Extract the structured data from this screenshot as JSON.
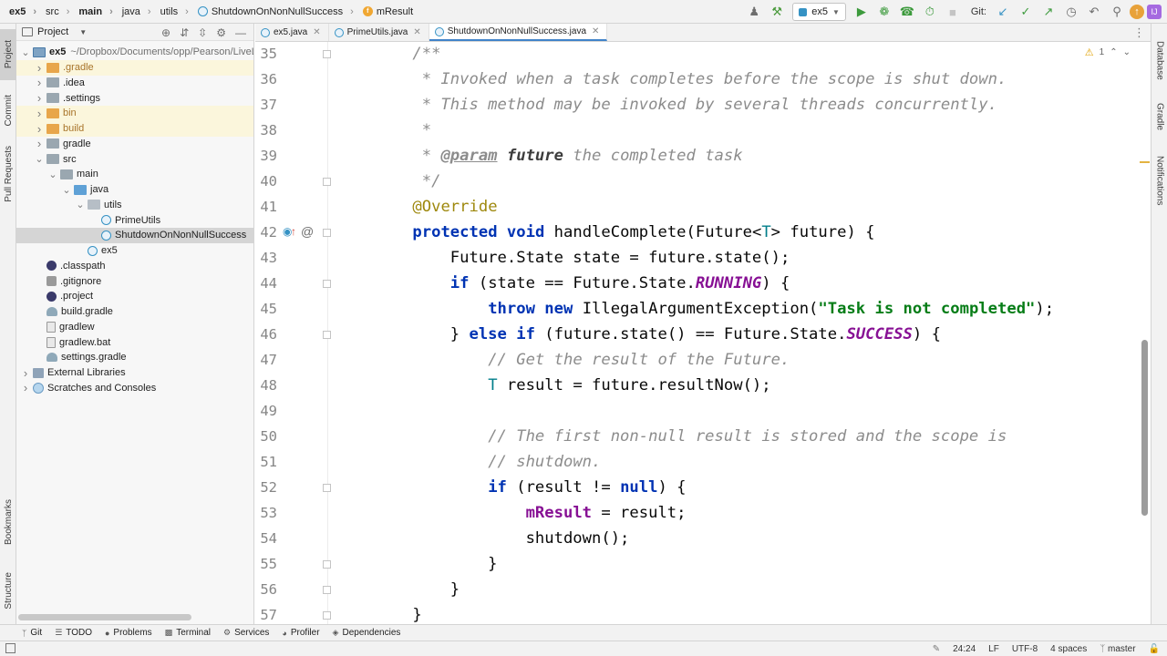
{
  "breadcrumbs": [
    "ex5",
    "src",
    "main",
    "java",
    "utils",
    "ShutdownOnNonNullSuccess",
    "mResult"
  ],
  "toolbar": {
    "run_config": "ex5",
    "git_label": "Git:"
  },
  "left_tools": [
    "Project",
    "Commit",
    "Pull Requests",
    "Bookmarks",
    "Structure"
  ],
  "right_tools": [
    "Database",
    "Gradle",
    "Notifications"
  ],
  "project_panel": {
    "title": "Project",
    "tree": [
      {
        "label": "ex5",
        "path": "~/Dropbox/Documents/opp/Pearson/LiveL",
        "depth": 0,
        "arrow": "down",
        "icon": "module-folder-icon"
      },
      {
        "label": ".gradle",
        "depth": 1,
        "arrow": "right",
        "icon": "folder-orange-icon"
      },
      {
        "label": ".idea",
        "depth": 1,
        "arrow": "right",
        "icon": "folder-icon"
      },
      {
        "label": ".settings",
        "depth": 1,
        "arrow": "right",
        "icon": "folder-icon"
      },
      {
        "label": "bin",
        "depth": 1,
        "arrow": "right",
        "icon": "folder-orange-icon"
      },
      {
        "label": "build",
        "depth": 1,
        "arrow": "right",
        "icon": "folder-orange-icon"
      },
      {
        "label": "gradle",
        "depth": 1,
        "arrow": "right",
        "icon": "folder-icon"
      },
      {
        "label": "src",
        "depth": 1,
        "arrow": "down",
        "icon": "folder-icon"
      },
      {
        "label": "main",
        "depth": 2,
        "arrow": "down",
        "icon": "folder-icon"
      },
      {
        "label": "java",
        "depth": 3,
        "arrow": "down",
        "icon": "folder-blue-icon"
      },
      {
        "label": "utils",
        "depth": 4,
        "arrow": "down",
        "icon": "package-icon"
      },
      {
        "label": "PrimeUtils",
        "depth": 5,
        "arrow": "",
        "icon": "class-icon"
      },
      {
        "label": "ShutdownOnNonNullSuccess",
        "depth": 5,
        "arrow": "",
        "icon": "class-icon"
      },
      {
        "label": "ex5",
        "depth": 4,
        "arrow": "",
        "icon": "class-icon"
      },
      {
        "label": ".classpath",
        "depth": 1,
        "arrow": "",
        "icon": "eclipse-icon"
      },
      {
        "label": ".gitignore",
        "depth": 1,
        "arrow": "",
        "icon": "git-file-icon"
      },
      {
        "label": ".project",
        "depth": 1,
        "arrow": "",
        "icon": "eclipse-icon"
      },
      {
        "label": "build.gradle",
        "depth": 1,
        "arrow": "",
        "icon": "gradle-icon"
      },
      {
        "label": "gradlew",
        "depth": 1,
        "arrow": "",
        "icon": "script-icon"
      },
      {
        "label": "gradlew.bat",
        "depth": 1,
        "arrow": "",
        "icon": "script-icon"
      },
      {
        "label": "settings.gradle",
        "depth": 1,
        "arrow": "",
        "icon": "gradle-icon"
      },
      {
        "label": "External Libraries",
        "depth": 0,
        "arrow": "right",
        "icon": "library-icon"
      },
      {
        "label": "Scratches and Consoles",
        "depth": 0,
        "arrow": "right",
        "icon": "scratch-icon"
      }
    ]
  },
  "editor_tabs": [
    {
      "label": "ex5.java",
      "active": false
    },
    {
      "label": "PrimeUtils.java",
      "active": false
    },
    {
      "label": "ShutdownOnNonNullSuccess.java",
      "active": true
    }
  ],
  "editor": {
    "inspection_count": "1",
    "lines": [
      {
        "num": "35",
        "tokens": [
          {
            "t": "    /**",
            "c": "cmt"
          }
        ]
      },
      {
        "num": "36",
        "tokens": [
          {
            "t": "     * Invoked when a task completes before the scope is shut down.",
            "c": "cmt"
          }
        ]
      },
      {
        "num": "37",
        "tokens": [
          {
            "t": "     * This method may be invoked by several threads concurrently.",
            "c": "cmt"
          }
        ]
      },
      {
        "num": "38",
        "tokens": [
          {
            "t": "     *",
            "c": "cmt"
          }
        ]
      },
      {
        "num": "39",
        "tokens": [
          {
            "t": "     * ",
            "c": "cmt"
          },
          {
            "t": "@param",
            "c": "doctag"
          },
          {
            "t": " ",
            "c": "cmt"
          },
          {
            "t": "future",
            "c": "docparam"
          },
          {
            "t": " the completed task",
            "c": "cmt"
          }
        ]
      },
      {
        "num": "40",
        "tokens": [
          {
            "t": "     */",
            "c": "cmt"
          }
        ]
      },
      {
        "num": "41",
        "tokens": [
          {
            "t": "    ",
            "c": ""
          },
          {
            "t": "@Override",
            "c": "ann"
          }
        ]
      },
      {
        "num": "42",
        "tokens": [
          {
            "t": "    ",
            "c": ""
          },
          {
            "t": "protected",
            "c": "kw"
          },
          {
            "t": " ",
            "c": ""
          },
          {
            "t": "void",
            "c": "kw"
          },
          {
            "t": " handleComplete(Future<",
            "c": ""
          },
          {
            "t": "T",
            "c": "type"
          },
          {
            "t": "> future) {",
            "c": ""
          }
        ]
      },
      {
        "num": "43",
        "tokens": [
          {
            "t": "        Future.State state = future.state();",
            "c": ""
          }
        ]
      },
      {
        "num": "44",
        "tokens": [
          {
            "t": "        ",
            "c": ""
          },
          {
            "t": "if",
            "c": "kw"
          },
          {
            "t": " (state == Future.State.",
            "c": ""
          },
          {
            "t": "RUNNING",
            "c": "static"
          },
          {
            "t": ") {",
            "c": ""
          }
        ]
      },
      {
        "num": "45",
        "tokens": [
          {
            "t": "            ",
            "c": ""
          },
          {
            "t": "throw",
            "c": "kw"
          },
          {
            "t": " ",
            "c": ""
          },
          {
            "t": "new",
            "c": "kw"
          },
          {
            "t": " IllegalArgumentException(",
            "c": ""
          },
          {
            "t": "\"Task is not completed\"",
            "c": "str"
          },
          {
            "t": ");",
            "c": ""
          }
        ]
      },
      {
        "num": "46",
        "tokens": [
          {
            "t": "        } ",
            "c": ""
          },
          {
            "t": "else",
            "c": "kw"
          },
          {
            "t": " ",
            "c": ""
          },
          {
            "t": "if",
            "c": "kw"
          },
          {
            "t": " (future.state() == Future.State.",
            "c": ""
          },
          {
            "t": "SUCCESS",
            "c": "static"
          },
          {
            "t": ") {",
            "c": ""
          }
        ]
      },
      {
        "num": "47",
        "tokens": [
          {
            "t": "            ",
            "c": ""
          },
          {
            "t": "// Get the result of the Future.",
            "c": "cmt"
          }
        ]
      },
      {
        "num": "48",
        "tokens": [
          {
            "t": "            ",
            "c": ""
          },
          {
            "t": "T",
            "c": "type"
          },
          {
            "t": " result = future.resultNow();",
            "c": ""
          }
        ]
      },
      {
        "num": "49",
        "tokens": [
          {
            "t": "",
            "c": ""
          }
        ]
      },
      {
        "num": "50",
        "tokens": [
          {
            "t": "            ",
            "c": ""
          },
          {
            "t": "// The first non-null result is stored and the scope is",
            "c": "cmt"
          }
        ]
      },
      {
        "num": "51",
        "tokens": [
          {
            "t": "            ",
            "c": ""
          },
          {
            "t": "// shutdown.",
            "c": "cmt"
          }
        ]
      },
      {
        "num": "52",
        "tokens": [
          {
            "t": "            ",
            "c": ""
          },
          {
            "t": "if",
            "c": "kw"
          },
          {
            "t": " (result != ",
            "c": ""
          },
          {
            "t": "null",
            "c": "kw"
          },
          {
            "t": ") {",
            "c": ""
          }
        ]
      },
      {
        "num": "53",
        "tokens": [
          {
            "t": "                ",
            "c": ""
          },
          {
            "t": "mResult",
            "c": "field"
          },
          {
            "t": " = result;",
            "c": ""
          }
        ]
      },
      {
        "num": "54",
        "tokens": [
          {
            "t": "                shutdown();",
            "c": ""
          }
        ]
      },
      {
        "num": "55",
        "tokens": [
          {
            "t": "            }",
            "c": ""
          }
        ]
      },
      {
        "num": "56",
        "tokens": [
          {
            "t": "        }",
            "c": ""
          }
        ]
      },
      {
        "num": "57",
        "tokens": [
          {
            "t": "    }",
            "c": ""
          }
        ]
      }
    ]
  },
  "bottom_tools": [
    "Git",
    "TODO",
    "Problems",
    "Terminal",
    "Services",
    "Profiler",
    "Dependencies"
  ],
  "status": {
    "caret": "24:24",
    "line_sep": "LF",
    "encoding": "UTF-8",
    "indent": "4 spaces",
    "branch": "master"
  },
  "colors": {
    "keyword": "#0033b3",
    "annotation": "#9e880d",
    "comment": "#8c8c8c",
    "string": "#067d17",
    "static_field": "#871094",
    "type_param": "#007e8a",
    "selection": "#d5d5d5",
    "excluded_folder": "#fbf6dc"
  }
}
